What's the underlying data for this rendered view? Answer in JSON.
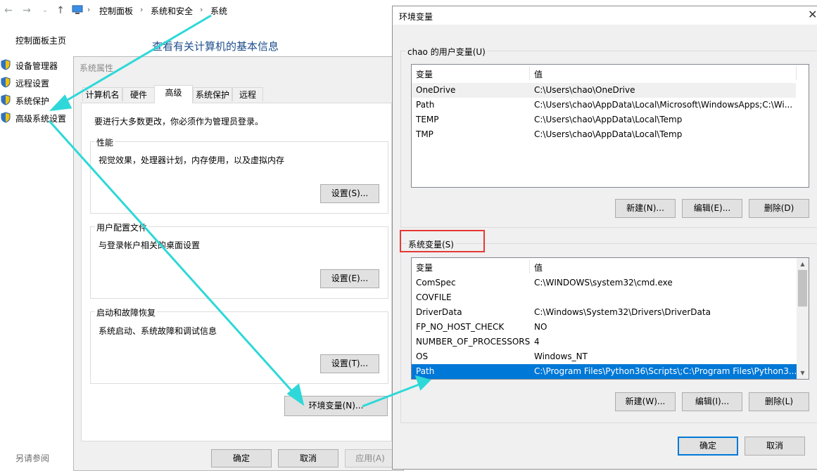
{
  "breadcrumb": [
    "控制面板",
    "系统和安全",
    "系统"
  ],
  "control_panel": {
    "home": "控制面板主页",
    "links": [
      "设备管理器",
      "远程设置",
      "系统保护",
      "高级系统设置"
    ],
    "title": "查看有关计算机的基本信息",
    "see_also": "另请参阅"
  },
  "system_properties": {
    "title": "系统属性",
    "tabs": [
      "计算机名",
      "硬件",
      "高级",
      "系统保护",
      "远程"
    ],
    "active_tab": "高级",
    "admin_note": "要进行大多数更改，你必须作为管理员登录。",
    "performance": {
      "title": "性能",
      "desc": "视觉效果，处理器计划，内存使用，以及虚拟内存",
      "button": "设置(S)..."
    },
    "user_profiles": {
      "title": "用户配置文件",
      "desc": "与登录帐户相关的桌面设置",
      "button": "设置(E)..."
    },
    "startup_recovery": {
      "title": "启动和故障恢复",
      "desc": "系统启动、系统故障和调试信息",
      "button": "设置(T)..."
    },
    "env_button": "环境变量(N)...",
    "ok": "确定",
    "cancel": "取消",
    "apply": "应用(A)"
  },
  "env_dialog": {
    "title": "环境变量",
    "user_section": "chao 的用户变量(U)",
    "system_section": "系统变量(S)",
    "col_var": "变量",
    "col_val": "值",
    "user_vars": [
      {
        "name": "OneDrive",
        "value": "C:\\Users\\chao\\OneDrive"
      },
      {
        "name": "Path",
        "value": "C:\\Users\\chao\\AppData\\Local\\Microsoft\\WindowsApps;C:\\Wi..."
      },
      {
        "name": "TEMP",
        "value": "C:\\Users\\chao\\AppData\\Local\\Temp"
      },
      {
        "name": "TMP",
        "value": "C:\\Users\\chao\\AppData\\Local\\Temp"
      }
    ],
    "system_vars": [
      {
        "name": "ComSpec",
        "value": "C:\\WINDOWS\\system32\\cmd.exe"
      },
      {
        "name": "COVFILE",
        "value": ""
      },
      {
        "name": "DriverData",
        "value": "C:\\Windows\\System32\\Drivers\\DriverData"
      },
      {
        "name": "FP_NO_HOST_CHECK",
        "value": "NO"
      },
      {
        "name": "NUMBER_OF_PROCESSORS",
        "value": "4"
      },
      {
        "name": "OS",
        "value": "Windows_NT"
      },
      {
        "name": "Path",
        "value": "C:\\Program Files\\Python36\\Scripts\\;C:\\Program Files\\Python3..."
      }
    ],
    "user_buttons": [
      "新建(N)...",
      "编辑(E)...",
      "删除(D)"
    ],
    "system_buttons": [
      "新建(W)...",
      "编辑(I)...",
      "删除(L)"
    ],
    "ok": "确定",
    "cancel": "取消",
    "close_icon": "✕"
  },
  "colors": {
    "selection": "#0078d7",
    "annotation_arrow": "#2ed8d8",
    "highlight_box": "#e53935"
  }
}
